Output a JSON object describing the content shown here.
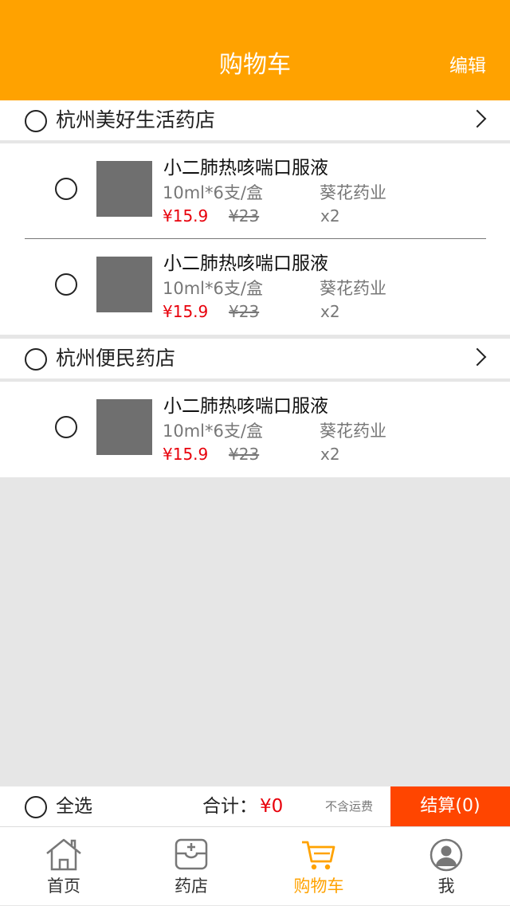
{
  "header": {
    "title": "购物车",
    "edit_label": "编辑"
  },
  "stores": [
    {
      "name": "杭州美好生活药店",
      "items": [
        {
          "name": "小二肺热咳喘口服液",
          "spec": "10ml*6支/盒",
          "maker": "葵花药业",
          "price": "¥15.9",
          "original_price": "¥23",
          "quantity": "x2"
        },
        {
          "name": "小二肺热咳喘口服液",
          "spec": "10ml*6支/盒",
          "maker": "葵花药业",
          "price": "¥15.9",
          "original_price": "¥23",
          "quantity": "x2"
        }
      ]
    },
    {
      "name": "杭州便民药店",
      "items": [
        {
          "name": "小二肺热咳喘口服液",
          "spec": "10ml*6支/盒",
          "maker": "葵花药业",
          "price": "¥15.9",
          "original_price": "¥23",
          "quantity": "x2"
        }
      ]
    }
  ],
  "footer": {
    "select_all": "全选",
    "total_label": "合计：",
    "total_value": "¥0",
    "shipping_note": "不含运费",
    "checkout_label": "结算(0)"
  },
  "tabbar": {
    "tabs": [
      {
        "label": "首页",
        "icon": "home-icon"
      },
      {
        "label": "药店",
        "icon": "pharmacy-icon"
      },
      {
        "label": "购物车",
        "icon": "cart-icon",
        "active": true
      },
      {
        "label": "我",
        "icon": "profile-icon"
      }
    ]
  },
  "colors": {
    "accent": "#ffa200",
    "checkout": "#ff4500",
    "price": "#e8000b"
  }
}
